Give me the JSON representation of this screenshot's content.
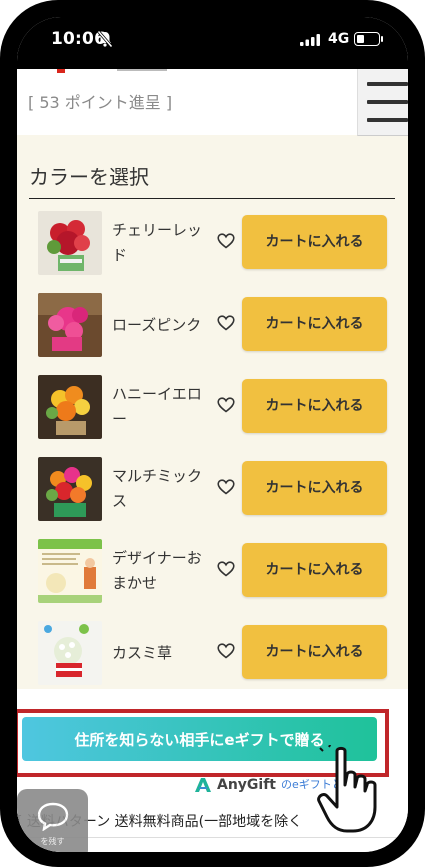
{
  "status_bar": {
    "time": "10:06",
    "network": "4G"
  },
  "header": {
    "points_text": "[ 53 ポイント進呈 ]"
  },
  "section": {
    "title": "カラーを選択"
  },
  "products": [
    {
      "name": "チェリーレッド",
      "button": "カートに入れる"
    },
    {
      "name": "ローズピンク",
      "button": "カートに入れる"
    },
    {
      "name": "ハニーイエロー",
      "button": "カートに入れる"
    },
    {
      "name": "マルチミックス",
      "button": "カートに入れる"
    },
    {
      "name": "デザイナーおまかせ",
      "button": "カートに入れる"
    },
    {
      "name": "カスミ草",
      "button": "カートに入れる"
    }
  ],
  "gift": {
    "button_label": "住所を知らない相手にeギフトで贈る"
  },
  "anygift": {
    "brand": "AnyGift",
    "help": "のeギフトとは？"
  },
  "shipping": {
    "text": "[ 送料パターン 送料無料商品(一部地域を除く"
  },
  "chat": {
    "label": "を残す"
  },
  "colors": {
    "cart_button": "#f1c040",
    "gift_start": "#4fc6e0",
    "gift_end": "#1fc29a",
    "highlight": "#c0262a",
    "panel_bg": "#f9f6ea"
  }
}
